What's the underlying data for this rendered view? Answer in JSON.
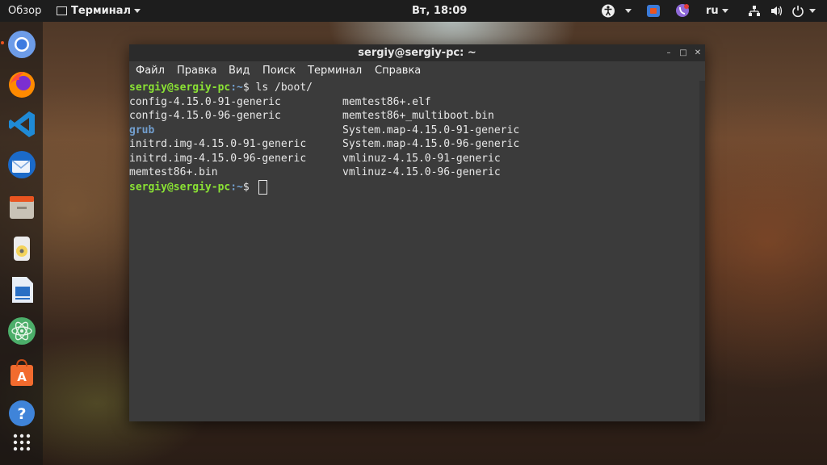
{
  "topbar": {
    "overview": "Обзор",
    "app_menu": "Терминал",
    "clock": "Вт, 18:09",
    "language": "ru"
  },
  "dock": {
    "apps": [
      "chromium",
      "firefox",
      "vscode",
      "thunderbird",
      "files",
      "rhythmbox",
      "writer",
      "atom",
      "software-center",
      "help",
      "show-apps"
    ]
  },
  "window": {
    "title": "sergiy@sergiy-pc: ~",
    "menu": [
      "Файл",
      "Правка",
      "Вид",
      "Поиск",
      "Терминал",
      "Справка"
    ]
  },
  "terminal": {
    "prompt_user": "sergiy@sergiy-pc",
    "prompt_path": ":~",
    "prompt_symbol": "$ ",
    "command": "ls /boot/",
    "files_left": [
      "config-4.15.0-91-generic",
      "config-4.15.0-96-generic",
      "grub",
      "initrd.img-4.15.0-91-generic",
      "initrd.img-4.15.0-96-generic",
      "memtest86+.bin"
    ],
    "files_right": [
      "memtest86+.elf",
      "memtest86+_multiboot.bin",
      "System.map-4.15.0-91-generic",
      "System.map-4.15.0-96-generic",
      "vmlinuz-4.15.0-91-generic",
      "vmlinuz-4.15.0-96-generic"
    ]
  }
}
